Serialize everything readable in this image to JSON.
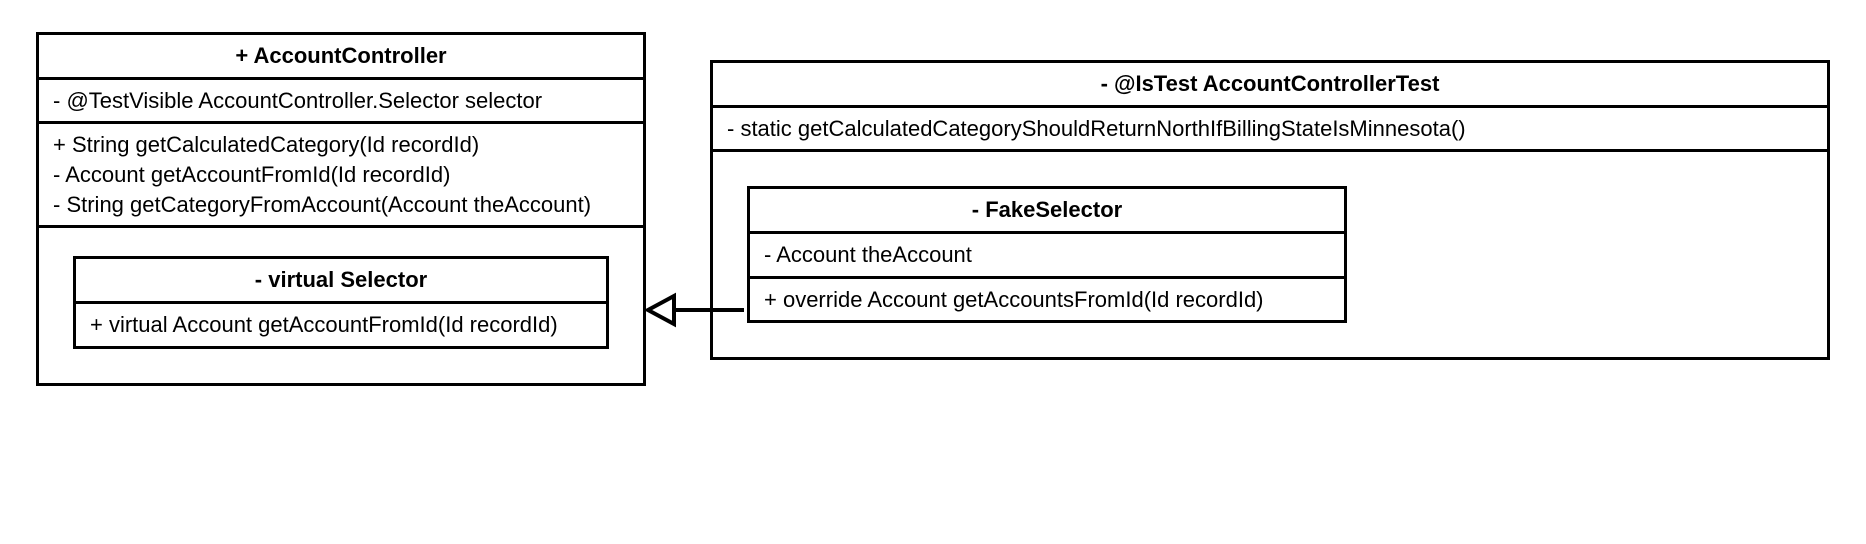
{
  "chart_data": {
    "type": "uml-class-diagram",
    "classes": [
      {
        "id": "AccountController",
        "visibility": "+",
        "name": "AccountController",
        "attributes": [
          "- @TestVisible AccountController.Selector selector"
        ],
        "methods": [
          "+ String getCalculatedCategory(Id recordId)",
          "- Account getAccountFromId(Id recordId)",
          "- String getCategoryFromAccount(Account theAccount)"
        ],
        "inner": [
          {
            "id": "Selector",
            "visibility": "-",
            "modifier": "virtual",
            "name": "Selector",
            "methods": [
              "+ virtual Account getAccountFromId(Id recordId)"
            ]
          }
        ]
      },
      {
        "id": "AccountControllerTest",
        "visibility": "-",
        "annotation": "@IsTest",
        "name": "AccountControllerTest",
        "methods": [
          "- static getCalculatedCategoryShouldReturnNorthIfBillingStateIsMinnesota()"
        ],
        "inner": [
          {
            "id": "FakeSelector",
            "visibility": "-",
            "name": "FakeSelector",
            "attributes": [
              "- Account theAccount"
            ],
            "methods": [
              "+ override Account getAccountsFromId(Id recordId)"
            ]
          }
        ]
      }
    ],
    "relationships": [
      {
        "from": "FakeSelector",
        "to": "Selector",
        "type": "generalization"
      }
    ]
  },
  "left": {
    "title": "+ AccountController",
    "attrs_line1": "- @TestVisible AccountController.Selector selector",
    "methods_line1": "+ String getCalculatedCategory(Id recordId)",
    "methods_line2": "- Account getAccountFromId(Id recordId)",
    "methods_line3": "- String getCategoryFromAccount(Account theAccount)",
    "inner": {
      "title": "- virtual Selector",
      "method": "+ virtual Account getAccountFromId(Id recordId)"
    }
  },
  "right": {
    "title": "- @IsTest AccountControllerTest",
    "method": "- static getCalculatedCategoryShouldReturnNorthIfBillingStateIsMinnesota()",
    "inner": {
      "title": "- FakeSelector",
      "attr": "- Account theAccount",
      "method": "+ override Account getAccountsFromId(Id recordId)"
    }
  }
}
